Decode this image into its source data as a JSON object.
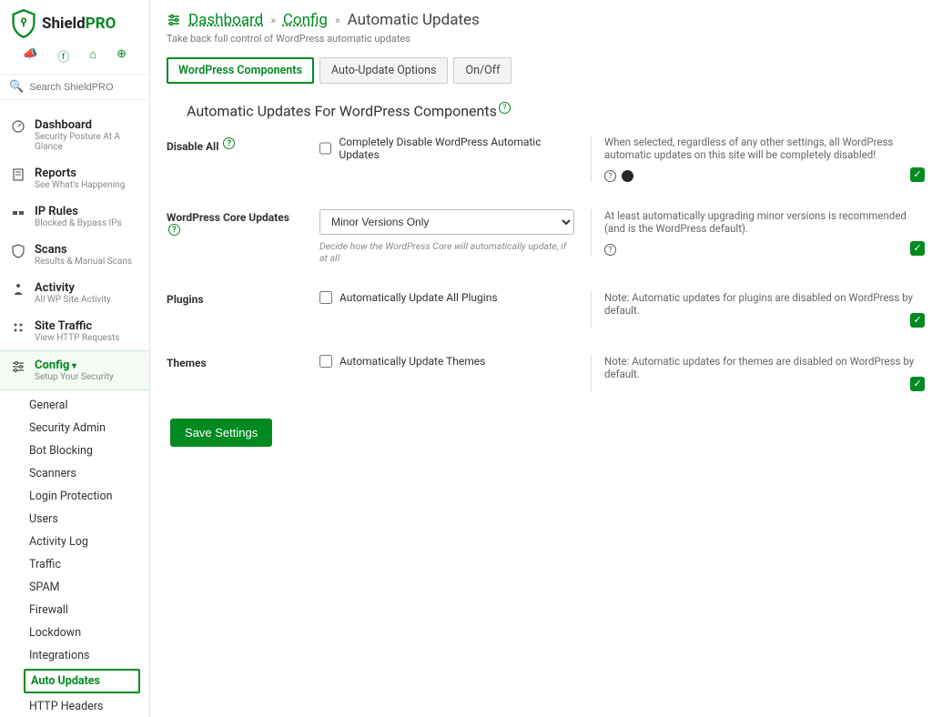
{
  "brand": {
    "name_a": "Shield",
    "name_b": "PRO"
  },
  "search": {
    "placeholder": "Search ShieldPRO"
  },
  "nav": [
    {
      "label": "Dashboard",
      "sub": "Security Posture At A Glance",
      "icon": "dashboard-icon"
    },
    {
      "label": "Reports",
      "sub": "See What's Happening",
      "icon": "reports-icon"
    },
    {
      "label": "IP Rules",
      "sub": "Blocked & Bypass IPs",
      "icon": "ip-icon"
    },
    {
      "label": "Scans",
      "sub": "Results & Manual Scans",
      "icon": "shield-icon"
    },
    {
      "label": "Activity",
      "sub": "All WP Site Activity",
      "icon": "activity-icon"
    },
    {
      "label": "Site Traffic",
      "sub": "View HTTP Requests",
      "icon": "traffic-icon"
    },
    {
      "label": "Config",
      "sub": "Setup Your Security",
      "icon": "sliders-icon",
      "active": true
    }
  ],
  "subnav": [
    "General",
    "Security Admin",
    "Bot Blocking",
    "Scanners",
    "Login Protection",
    "Users",
    "Activity Log",
    "Traffic",
    "SPAM",
    "Firewall",
    "Lockdown",
    "Integrations",
    "Auto Updates",
    "HTTP Headers"
  ],
  "subnav_active": "Auto Updates",
  "breadcrumb": {
    "a": "Dashboard",
    "b": "Config",
    "c": "Automatic Updates"
  },
  "page_sub": "Take back full control of WordPress automatic updates",
  "tabs": [
    "WordPress Components",
    "Auto-Update Options",
    "On/Off"
  ],
  "tab_active": "WordPress Components",
  "section_title": "Automatic Updates For WordPress Components",
  "rows": {
    "disable": {
      "label": "Disable All",
      "checkbox": "Completely Disable WordPress Automatic Updates",
      "desc": "When selected, regardless of any other settings, all WordPress automatic updates on this site will be completely disabled!"
    },
    "core": {
      "label": "WordPress Core Updates",
      "select_value": "Minor Versions Only",
      "hint": "Decide how the WordPress Core will automatically update, if at all",
      "desc": "At least automatically upgrading minor versions is recommended (and is the WordPress default)."
    },
    "plugins": {
      "label": "Plugins",
      "checkbox": "Automatically Update All Plugins",
      "desc": "Note: Automatic updates for plugins are disabled on WordPress by default."
    },
    "themes": {
      "label": "Themes",
      "checkbox": "Automatically Update Themes",
      "desc": "Note: Automatic updates for themes are disabled on WordPress by default."
    }
  },
  "save_label": "Save Settings"
}
